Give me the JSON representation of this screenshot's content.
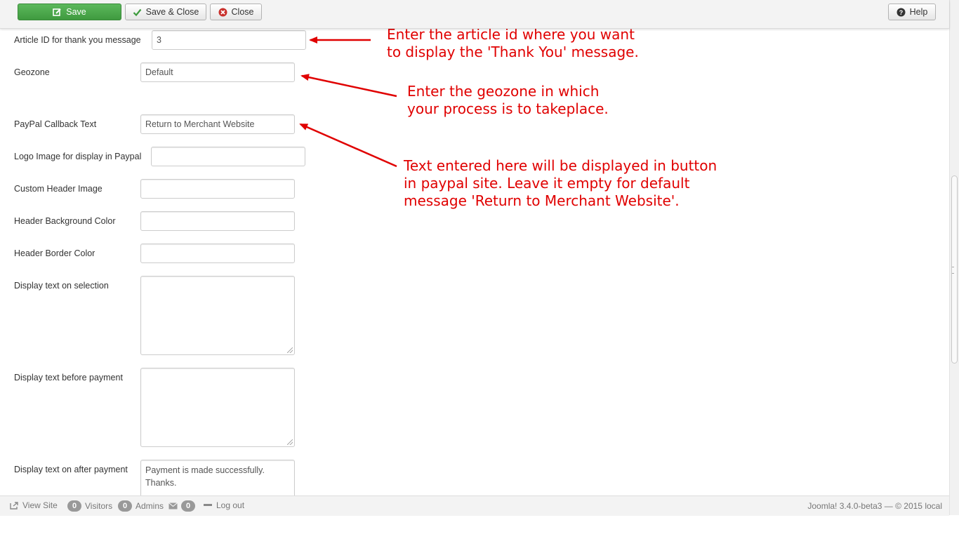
{
  "toolbar": {
    "save_label": "Save",
    "save_close_label": "Save & Close",
    "close_label": "Close",
    "help_label": "Help",
    "save_icon": "edit-icon",
    "save_close_icon": "check-icon",
    "close_icon": "cancel-circle-icon",
    "help_icon": "question-circle-icon",
    "save_color": "#46a546"
  },
  "form": {
    "article_id": {
      "label": "Article ID for thank you message",
      "value": "3"
    },
    "geozone": {
      "label": "Geozone",
      "value": "Default"
    },
    "paypal_callback": {
      "label": "PayPal Callback Text",
      "value": "Return to Merchant Website"
    },
    "logo_image": {
      "label": "Logo Image for display in Paypal",
      "value": ""
    },
    "custom_header_image": {
      "label": "Custom Header Image",
      "value": ""
    },
    "header_bg_color": {
      "label": "Header Background Color",
      "value": ""
    },
    "header_border_color": {
      "label": "Header Border Color",
      "value": ""
    },
    "text_on_selection": {
      "label": "Display text on selection",
      "value": ""
    },
    "text_before_payment": {
      "label": "Display text before payment",
      "value": ""
    },
    "text_after_payment": {
      "label": "Display text on after payment",
      "value": "Payment is made successfully.\nThanks."
    }
  },
  "annotations": {
    "color": "#e00000",
    "note1": "Enter the article id where you want\nto display the 'Thank You' message.",
    "note2": "Enter the geozone in which\nyour process is to takeplace.",
    "note3": "Text entered here will be displayed in button\nin paypal site. Leave it empty for default\nmessage 'Return to Merchant Website'."
  },
  "statusbar": {
    "view_site": "View Site",
    "visitors_count": "0",
    "visitors_label": "Visitors",
    "admins_count": "0",
    "admins_label": "Admins",
    "messages_count": "0",
    "logout_label": "Log out",
    "version": "Joomla! 3.4.0-beta3 — © 2015 local"
  }
}
